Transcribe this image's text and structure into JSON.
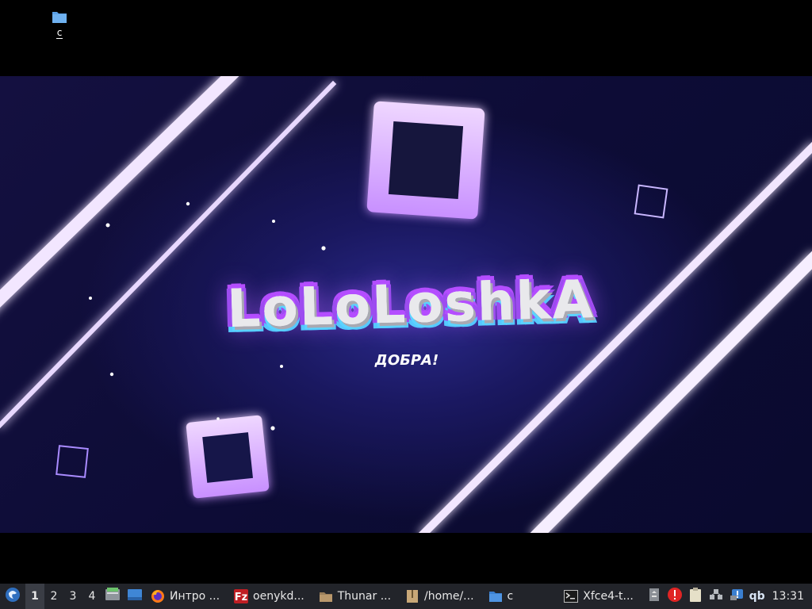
{
  "desktop": {
    "icons": [
      {
        "label": "c",
        "icon": "folder-icon"
      }
    ]
  },
  "wallpaper": {
    "title": "LoLoLoshkA",
    "subtitle": "ДОБРА!",
    "colors": {
      "accent": "#b44dff",
      "glow": "#5bd3ff",
      "background": "#0d0c36"
    }
  },
  "taskbar": {
    "menu_icon": "app-menu-icon",
    "workspaces": [
      "1",
      "2",
      "3",
      "4"
    ],
    "active_workspace": "1",
    "quick_icons": [
      "file-manager-icon",
      "show-desktop-icon"
    ],
    "tasks": [
      {
        "icon": "firefox-icon",
        "label": "Интро ..."
      },
      {
        "icon": "filezilla-icon",
        "label": "oenykd..."
      },
      {
        "icon": "thunar-icon",
        "label": "Thunar ..."
      },
      {
        "icon": "archive-icon",
        "label": "/home/..."
      },
      {
        "icon": "folder-icon",
        "label": "c"
      },
      {
        "icon": "terminal-icon",
        "label": "Xfce4-t..."
      }
    ],
    "tray": [
      "disk-icon",
      "alert-icon",
      "clipboard-icon",
      "network-icon",
      "updates-icon",
      "qbittorrent-icon"
    ],
    "qb_label": "qb",
    "clock": "13:31"
  }
}
